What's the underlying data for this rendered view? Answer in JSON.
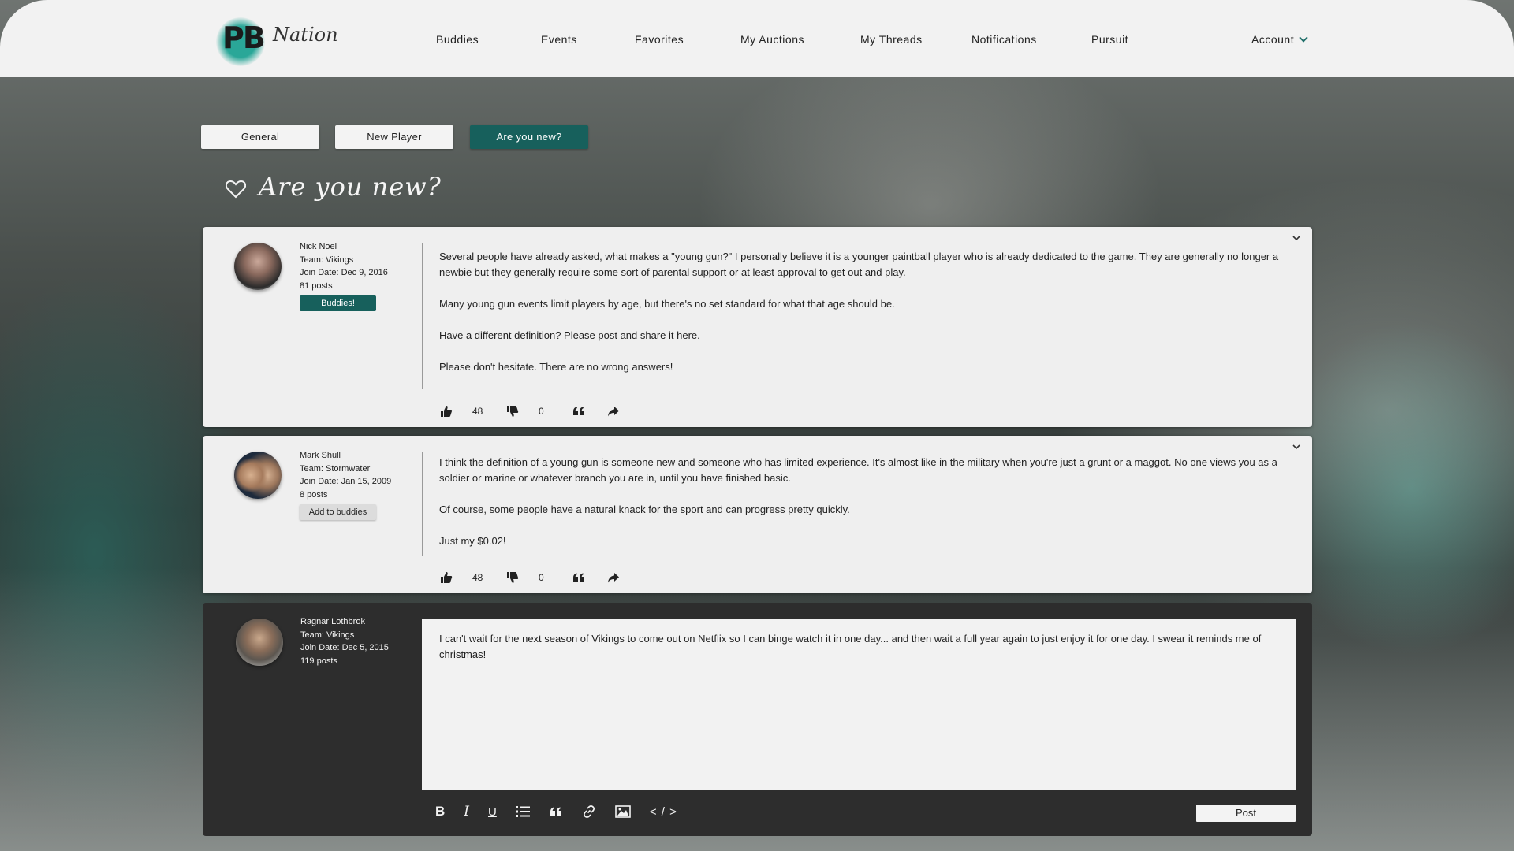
{
  "brand": {
    "logo_initials": "PB",
    "logo_word": "Nation"
  },
  "nav": {
    "items": [
      {
        "label": "Buddies"
      },
      {
        "label": "Events"
      },
      {
        "label": "Favorites"
      },
      {
        "label": "My Auctions"
      },
      {
        "label": "My Threads"
      },
      {
        "label": "Notifications"
      },
      {
        "label": "Pursuit"
      }
    ],
    "account_label": "Account"
  },
  "tabs": [
    {
      "label": "General",
      "active": false
    },
    {
      "label": "New Player",
      "active": false
    },
    {
      "label": "Are you new?",
      "active": true
    }
  ],
  "thread": {
    "title": "Are you new?"
  },
  "posts": [
    {
      "author": "Nick Noel",
      "team": "Team: Vikings",
      "join_date": "Join Date: Dec 9, 2016",
      "post_count": "81 posts",
      "relation_label": "Buddies!",
      "paragraphs": [
        "Several people have already asked, what makes a \"young gun?\" I personally believe it is a younger paintball player who is already dedicated to the game. They are generally no longer a newbie but they generally require some sort of parental support or at least approval to get out and play.",
        "Many young gun events limit players by age, but there's no set standard for what that age should be.",
        "Have a different definition? Please post and share it here.",
        "Please don't hesitate. There are no wrong answers!"
      ],
      "likes": "48",
      "dislikes": "0"
    },
    {
      "author": "Mark Shull",
      "team": "Team: Stormwater",
      "join_date": "Join Date: Jan 15, 2009",
      "post_count": "8 posts",
      "relation_label": "Add to buddies",
      "paragraphs": [
        "I think the definition of a young gun is someone new and someone who has limited experience. It's almost like in the military when you're just a grunt or a maggot. No one views you as a soldier or marine or whatever branch you are in, until you have finished basic.",
        "Of course, some people have a natural knack for the sport and can progress pretty quickly.",
        "Just my $0.02!"
      ],
      "likes": "48",
      "dislikes": "0"
    }
  ],
  "composer": {
    "author": "Ragnar Lothbrok",
    "team": "Team: Vikings",
    "join_date": "Join Date: Dec 5, 2015",
    "post_count": "119 posts",
    "draft_text": "I can't wait for the next season of Vikings to come out on Netflix so I can binge watch it in one day... and then wait a full year again to just enjoy it for one day. I swear it reminds me of christmas!",
    "toolbar": {
      "bold": "B",
      "italic": "I",
      "underline": "U",
      "code": "< / >"
    },
    "post_label": "Post"
  },
  "colors": {
    "accent": "#17605c",
    "splash": "#2aa798",
    "header_bg": "#f2f2f2",
    "card_bg": "#efefef",
    "composer_bg": "#2d2d2d"
  }
}
